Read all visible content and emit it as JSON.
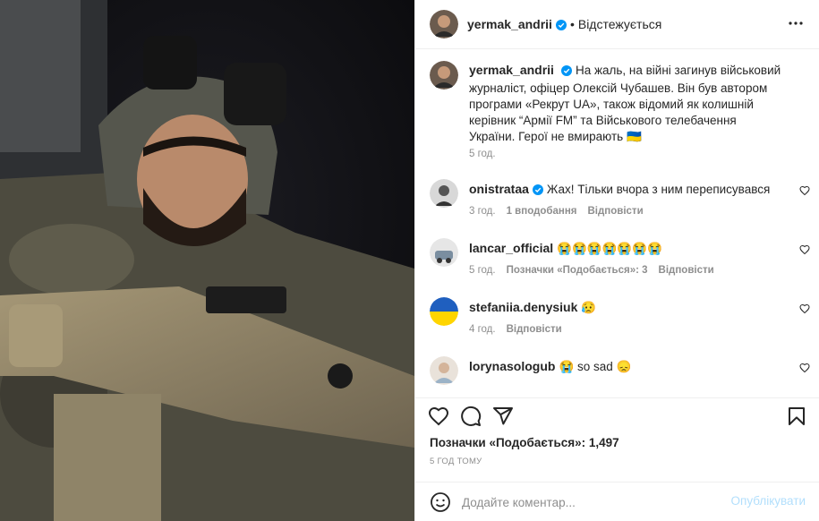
{
  "post": {
    "photo_description": "Selfie of a soldier wearing a helmet with night-vision mount, holding a tan rifle in a dark vehicle",
    "author": {
      "username": "yermak_andrii",
      "verified": true,
      "follow_status": "Відстежується"
    },
    "caption": {
      "username": "yermak_andrii",
      "text": "На жаль, на війні загинув військовий журналіст, офіцер Олексій Чубашев. Він був автором програми «Рекрут UA», також відомий як колишній керівник “Армії FM” та Військового телебачення України. Герої не вмирають 🇺🇦",
      "time": "5 год."
    },
    "comments": [
      {
        "username": "onistrataa",
        "verified": true,
        "text": "Жах! Тільки вчора з ним переписувався",
        "time": "3 год.",
        "likes": "1 вподобання",
        "reply": "Відповісти"
      },
      {
        "username": "lancar_official",
        "verified": false,
        "text": "😭😭😭😭😭😭😭",
        "time": "5 год.",
        "likes": "Позначки «Подобається»: 3",
        "reply": "Відповісти"
      },
      {
        "username": "stefaniia.denysiuk",
        "verified": false,
        "text": "😥",
        "time": "4 год.",
        "likes": "",
        "reply": "Відповісти"
      },
      {
        "username": "lorynasologub",
        "verified": false,
        "text": "😭 so sad 😞",
        "time": "",
        "likes": "",
        "reply": ""
      }
    ],
    "likes_label": "Позначки «Подобається»: 1,497",
    "time_ago": "5 ГОД ТОМУ",
    "add_comment": {
      "placeholder": "Додайте коментар...",
      "post_label": "Опублікувати"
    },
    "icons": {
      "more": "more-icon",
      "like": "heart-icon",
      "comment": "comment-icon",
      "share": "share-icon",
      "save": "bookmark-icon",
      "emoji": "emoji-icon",
      "verified": "verified-badge-icon"
    },
    "colors": {
      "verified": "#0095f6",
      "post_button_disabled": "#b2dffc",
      "meta_text": "#8e8e8e"
    }
  }
}
